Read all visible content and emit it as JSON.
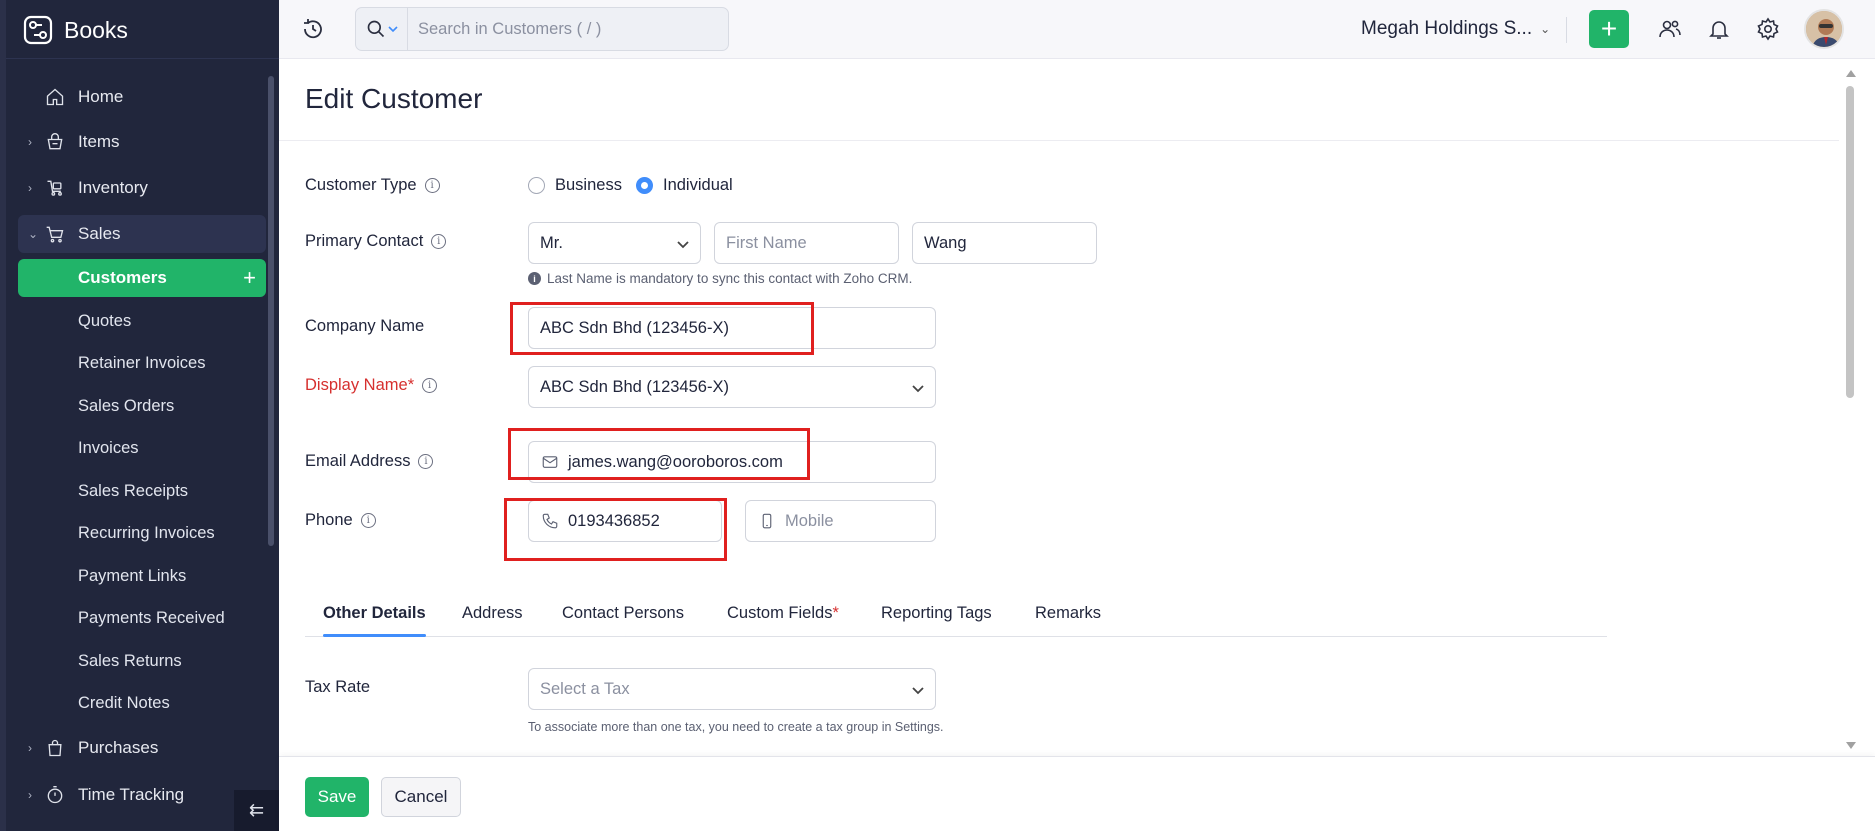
{
  "app": {
    "brand": "Books",
    "colors": {
      "sidebar": "#21263c",
      "accent": "#21b469",
      "link": "#408dfb",
      "highlight": "#e0201f",
      "required": "#d6302f"
    }
  },
  "sidebar": {
    "items": [
      {
        "label": "Home",
        "icon": "home-icon"
      },
      {
        "label": "Items",
        "icon": "basket-icon"
      },
      {
        "label": "Inventory",
        "icon": "box-icon"
      },
      {
        "label": "Sales",
        "icon": "cart-icon"
      },
      {
        "label": "Purchases",
        "icon": "bag-icon"
      },
      {
        "label": "Time Tracking",
        "icon": "stopwatch-icon"
      }
    ],
    "sales_sub": [
      "Customers",
      "Quotes",
      "Retainer Invoices",
      "Sales Orders",
      "Invoices",
      "Sales Receipts",
      "Recurring Invoices",
      "Payment Links",
      "Payments Received",
      "Sales Returns",
      "Credit Notes"
    ]
  },
  "topbar": {
    "search_placeholder": "Search in Customers ( / )",
    "org_name": "Megah Holdings S..."
  },
  "form": {
    "title": "Edit Customer",
    "customer_type": {
      "label": "Customer Type",
      "options": [
        "Business",
        "Individual"
      ],
      "selected": "Individual"
    },
    "primary_contact": {
      "label": "Primary Contact",
      "salutation": "Mr.",
      "first_name_placeholder": "First Name",
      "last_name": "Wang",
      "hint": "Last Name is mandatory to sync this contact with Zoho CRM."
    },
    "company_name": {
      "label": "Company Name",
      "value": "ABC Sdn Bhd (123456-X)"
    },
    "display_name": {
      "label": "Display Name*",
      "value": "ABC Sdn Bhd (123456-X)"
    },
    "email": {
      "label": "Email Address",
      "value": "james.wang@ooroboros.com"
    },
    "phone": {
      "label": "Phone",
      "work": "0193436852",
      "mobile_placeholder": "Mobile"
    },
    "tabs": [
      {
        "label": "Other Details",
        "required": false
      },
      {
        "label": "Address",
        "required": false
      },
      {
        "label": "Contact Persons",
        "required": false
      },
      {
        "label": "Custom Fields",
        "required": true
      },
      {
        "label": "Reporting Tags",
        "required": false
      },
      {
        "label": "Remarks",
        "required": false
      }
    ],
    "tax_rate": {
      "label": "Tax Rate",
      "placeholder": "Select a Tax",
      "help": "To associate more than one tax, you need to create a tax group in Settings."
    }
  },
  "footer": {
    "save": "Save",
    "cancel": "Cancel"
  }
}
